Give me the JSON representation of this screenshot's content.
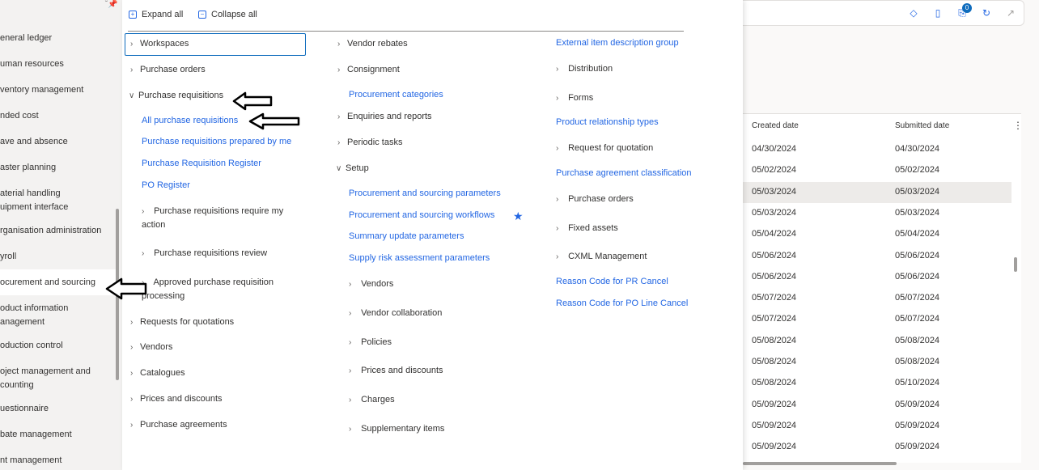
{
  "left_nav": {
    "items": [
      {
        "label": "eneral ledger"
      },
      {
        "label": "uman resources"
      },
      {
        "label": "ventory management"
      },
      {
        "label": "nded cost"
      },
      {
        "label": "ave and absence"
      },
      {
        "label": "aster planning"
      },
      {
        "label": "aterial handling\nuipment interface"
      },
      {
        "label": "rganisation administration"
      },
      {
        "label": "yroll"
      },
      {
        "label": "ocurement and sourcing"
      },
      {
        "label": "oduct information\nanagement"
      },
      {
        "label": "oduction control"
      },
      {
        "label": "oject management and\ncounting"
      },
      {
        "label": "uestionnaire"
      },
      {
        "label": "bate management"
      },
      {
        "label": "nt management"
      }
    ]
  },
  "toolbar": {
    "expand_all": "Expand all",
    "collapse_all": "Collapse all"
  },
  "col1": {
    "workspaces": "Workspaces",
    "purchase_orders": "Purchase orders",
    "purchase_requisitions": "Purchase requisitions",
    "all_purchase_requisitions": "All purchase requisitions",
    "prepared_by_me": "Purchase requisitions prepared by me",
    "register": "Purchase Requisition Register",
    "po_register": "PO Register",
    "require_my_action": "Purchase requisitions require my action",
    "review": "Purchase requisitions review",
    "approved_processing": "Approved purchase requisition processing",
    "rfq": "Requests for quotations",
    "vendors": "Vendors",
    "catalogues": "Catalogues",
    "prices_discounts": "Prices and discounts",
    "purchase_agreements": "Purchase agreements"
  },
  "col2": {
    "vendor_rebates": "Vendor rebates",
    "consignment": "Consignment",
    "procurement_categories": "Procurement categories",
    "enquiries_reports": "Enquiries and reports",
    "periodic_tasks": "Periodic tasks",
    "setup": "Setup",
    "proc_params": "Procurement and sourcing parameters",
    "proc_workflows": "Procurement and sourcing workflows",
    "summary_update": "Summary update parameters",
    "supply_risk": "Supply risk assessment parameters",
    "vendors": "Vendors",
    "vendor_collab": "Vendor collaboration",
    "policies": "Policies",
    "prices_discounts": "Prices and discounts",
    "charges": "Charges",
    "supplementary": "Supplementary items"
  },
  "col3": {
    "ext_item_desc": "External item description group",
    "distribution": "Distribution",
    "forms": "Forms",
    "product_relationship": "Product relationship types",
    "rfq": "Request for quotation",
    "agreement_class": "Purchase agreement classification",
    "purchase_orders": "Purchase orders",
    "fixed_assets": "Fixed assets",
    "cxml": "CXML Management",
    "reason_pr_cancel": "Reason Code for PR Cancel",
    "reason_po_line_cancel": "Reason Code for PO Line Cancel"
  },
  "grid": {
    "headers": {
      "created": "Created date",
      "submitted": "Submitted date"
    },
    "rows": [
      {
        "created": "04/30/2024",
        "submitted": "04/30/2024"
      },
      {
        "created": "05/02/2024",
        "submitted": "05/02/2024"
      },
      {
        "created": "05/03/2024",
        "submitted": "05/03/2024"
      },
      {
        "created": "05/03/2024",
        "submitted": "05/03/2024"
      },
      {
        "created": "05/04/2024",
        "submitted": "05/04/2024"
      },
      {
        "created": "05/06/2024",
        "submitted": "05/06/2024"
      },
      {
        "created": "05/06/2024",
        "submitted": "05/06/2024"
      },
      {
        "created": "05/07/2024",
        "submitted": "05/07/2024"
      },
      {
        "created": "05/07/2024",
        "submitted": "05/07/2024"
      },
      {
        "created": "05/08/2024",
        "submitted": "05/08/2024"
      },
      {
        "created": "05/08/2024",
        "submitted": "05/08/2024"
      },
      {
        "created": "05/08/2024",
        "submitted": "05/10/2024"
      },
      {
        "created": "05/09/2024",
        "submitted": "05/09/2024"
      },
      {
        "created": "05/09/2024",
        "submitted": "05/09/2024"
      },
      {
        "created": "05/09/2024",
        "submitted": "05/09/2024"
      }
    ],
    "selected_row": 2
  },
  "header_icons": {
    "notification_count": "0",
    "icons": [
      "diamond-icon",
      "book-icon",
      "attachment-icon",
      "refresh-icon",
      "open-new-icon"
    ]
  },
  "accent_color": "#2266e3"
}
